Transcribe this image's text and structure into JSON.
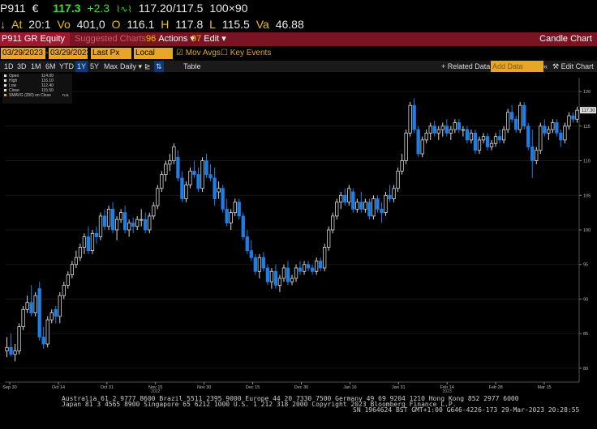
{
  "quote": {
    "ticker": "P911",
    "currency": "€",
    "last": "117.3",
    "change": "+2.3",
    "bid_ask": "117.20/117.5",
    "size": "100×90",
    "at_label": "At",
    "at_time": "20:1",
    "vol_label": "Vo",
    "volume": "401,0",
    "open_label": "O",
    "open": "116.1",
    "high_label": "H",
    "high": "117.8",
    "low_label": "L",
    "low": "115.5",
    "val_label": "Va",
    "value": "46.88"
  },
  "titlebar": {
    "security": "P911 GR Equity",
    "suggested": "Suggested Charts",
    "actions_num": "96",
    "actions": "Actions",
    "edit_num": "97",
    "edit": "Edit",
    "chart_name": "Candle Chart"
  },
  "toolbar": {
    "start_date": "03/29/2023",
    "end_date": "03/29/2023",
    "field": "Last Px",
    "currency": "Local CCY",
    "mov_avgs": "Mov Avgs",
    "key_events": "Key Events",
    "periods": [
      "1D",
      "3D",
      "1M",
      "6M",
      "YTD",
      "1Y",
      "5Y",
      "Max"
    ],
    "active_period": "1Y",
    "frequency": "Daily",
    "table": "Table",
    "related": "Related Data",
    "add_data": "Add Data",
    "edit_chart": "Edit Chart"
  },
  "legend": {
    "rows": [
      {
        "k": "Open",
        "v": "114.00"
      },
      {
        "k": "High",
        "v": "116.10"
      },
      {
        "k": "Low",
        "v": "112.40"
      },
      {
        "k": "Close",
        "v": "115.50"
      },
      {
        "k": "SMAVG (200) on Close",
        "v": "n.a."
      }
    ]
  },
  "footer": {
    "line1": "Australia 61 2 9777 8600 Brazil 5511 2395 9000 Europe 44 20 7330 7500 Germany 49 69 9204 1210 Hong Kong 852 2977 6000",
    "line2": "Japan 81 3 4565 8900     Singapore 65 6212 1000     U.S. 1 212 318 2000          Copyright 2023 Bloomberg Finance L.P.",
    "line3": "SN 1964624 BST  GMT+1:00 G646-4226-173 29-Mar-2023 20:28:55"
  },
  "colors": {
    "up": "#d8d8d8",
    "down": "#1e7ee8",
    "accent": "#e8a628",
    "title": "#7a1422"
  },
  "chart_data": {
    "type": "candlestick",
    "ylim": [
      78,
      122
    ],
    "yticks": [
      80,
      85,
      90,
      95,
      100,
      105,
      110,
      115,
      120
    ],
    "x_ticks": [
      "Sep 30",
      "Oct 14",
      "Oct 31",
      "Nov 15",
      "Nov 30",
      "Dec 15",
      "Dec 30",
      "Jan 16",
      "Jan 31",
      "Feb 14",
      "Feb 28",
      "Mar 15"
    ],
    "x_year_labels": [
      {
        "under": "Nov 15",
        "text": "2022"
      },
      {
        "under": "Feb 14",
        "text": "2023"
      }
    ],
    "last_price": "117.30",
    "candles": [
      {
        "o": 82.5,
        "h": 84.5,
        "l": 81.6,
        "c": 83.0
      },
      {
        "o": 83.0,
        "h": 85.0,
        "l": 81.7,
        "c": 82.0
      },
      {
        "o": 82.0,
        "h": 83.5,
        "l": 81.0,
        "c": 82.5
      },
      {
        "o": 82.5,
        "h": 86.5,
        "l": 82.0,
        "c": 86.0
      },
      {
        "o": 86.0,
        "h": 89.0,
        "l": 85.5,
        "c": 88.5
      },
      {
        "o": 88.5,
        "h": 90.5,
        "l": 88.0,
        "c": 89.5
      },
      {
        "o": 89.5,
        "h": 92.0,
        "l": 87.5,
        "c": 88.0
      },
      {
        "o": 88.0,
        "h": 91.0,
        "l": 87.5,
        "c": 90.5
      },
      {
        "o": 91.5,
        "h": 92.5,
        "l": 84.0,
        "c": 84.5
      },
      {
        "o": 84.5,
        "h": 86.0,
        "l": 82.8,
        "c": 83.5
      },
      {
        "o": 83.5,
        "h": 87.5,
        "l": 83.0,
        "c": 87.0
      },
      {
        "o": 87.0,
        "h": 88.5,
        "l": 86.5,
        "c": 88.0
      },
      {
        "o": 88.5,
        "h": 89.0,
        "l": 86.5,
        "c": 87.5
      },
      {
        "o": 87.5,
        "h": 91.0,
        "l": 86.5,
        "c": 90.5
      },
      {
        "o": 90.5,
        "h": 92.5,
        "l": 90.0,
        "c": 92.0
      },
      {
        "o": 92.0,
        "h": 94.0,
        "l": 91.5,
        "c": 93.5
      },
      {
        "o": 93.5,
        "h": 95.5,
        "l": 93.0,
        "c": 95.0
      },
      {
        "o": 95.0,
        "h": 97.0,
        "l": 94.5,
        "c": 96.0
      },
      {
        "o": 96.0,
        "h": 98.0,
        "l": 95.5,
        "c": 97.5
      },
      {
        "o": 97.5,
        "h": 99.5,
        "l": 96.5,
        "c": 99.0
      },
      {
        "o": 99.0,
        "h": 100.5,
        "l": 96.5,
        "c": 97.0
      },
      {
        "o": 97.0,
        "h": 100.0,
        "l": 96.5,
        "c": 99.5
      },
      {
        "o": 99.5,
        "h": 100.5,
        "l": 98.0,
        "c": 99.0
      },
      {
        "o": 99.0,
        "h": 102.5,
        "l": 98.5,
        "c": 102.0
      },
      {
        "o": 102.0,
        "h": 103.0,
        "l": 100.0,
        "c": 100.5
      },
      {
        "o": 100.5,
        "h": 103.5,
        "l": 100.0,
        "c": 103.0
      },
      {
        "o": 103.0,
        "h": 104.0,
        "l": 99.5,
        "c": 100.0
      },
      {
        "o": 100.0,
        "h": 102.0,
        "l": 98.5,
        "c": 101.5
      },
      {
        "o": 101.5,
        "h": 103.0,
        "l": 101.0,
        "c": 102.5
      },
      {
        "o": 102.5,
        "h": 103.5,
        "l": 99.5,
        "c": 100.0
      },
      {
        "o": 100.0,
        "h": 101.5,
        "l": 99.0,
        "c": 101.0
      },
      {
        "o": 101.0,
        "h": 101.8,
        "l": 99.5,
        "c": 100.5
      },
      {
        "o": 100.5,
        "h": 102.0,
        "l": 100.0,
        "c": 101.5
      },
      {
        "o": 101.5,
        "h": 103.0,
        "l": 100.5,
        "c": 101.5
      },
      {
        "o": 101.5,
        "h": 102.5,
        "l": 99.5,
        "c": 100.0
      },
      {
        "o": 100.0,
        "h": 102.5,
        "l": 99.5,
        "c": 102.0
      },
      {
        "o": 102.0,
        "h": 104.0,
        "l": 101.5,
        "c": 103.5
      },
      {
        "o": 103.5,
        "h": 106.5,
        "l": 103.0,
        "c": 106.0
      },
      {
        "o": 106.0,
        "h": 108.5,
        "l": 105.5,
        "c": 108.0
      },
      {
        "o": 108.0,
        "h": 110.0,
        "l": 107.0,
        "c": 109.5
      },
      {
        "o": 109.5,
        "h": 111.0,
        "l": 108.5,
        "c": 110.0
      },
      {
        "o": 110.0,
        "h": 112.5,
        "l": 109.5,
        "c": 112.0
      },
      {
        "o": 110.5,
        "h": 111.5,
        "l": 107.0,
        "c": 107.5
      },
      {
        "o": 107.5,
        "h": 108.5,
        "l": 104.0,
        "c": 104.5
      },
      {
        "o": 104.5,
        "h": 107.0,
        "l": 104.0,
        "c": 106.5
      },
      {
        "o": 106.5,
        "h": 109.0,
        "l": 106.0,
        "c": 108.5
      },
      {
        "o": 108.5,
        "h": 110.0,
        "l": 107.5,
        "c": 108.0
      },
      {
        "o": 108.0,
        "h": 109.0,
        "l": 105.5,
        "c": 106.0
      },
      {
        "o": 106.0,
        "h": 110.5,
        "l": 105.5,
        "c": 110.0
      },
      {
        "o": 110.0,
        "h": 111.0,
        "l": 107.5,
        "c": 108.0
      },
      {
        "o": 108.0,
        "h": 109.5,
        "l": 107.0,
        "c": 107.5
      },
      {
        "o": 107.5,
        "h": 109.0,
        "l": 103.5,
        "c": 104.5
      },
      {
        "o": 105.5,
        "h": 107.0,
        "l": 104.5,
        "c": 106.0
      },
      {
        "o": 106.0,
        "h": 106.5,
        "l": 102.5,
        "c": 103.0
      },
      {
        "o": 103.0,
        "h": 104.5,
        "l": 100.5,
        "c": 101.0
      },
      {
        "o": 101.0,
        "h": 103.0,
        "l": 100.0,
        "c": 102.5
      },
      {
        "o": 102.5,
        "h": 104.5,
        "l": 102.0,
        "c": 104.0
      },
      {
        "o": 104.0,
        "h": 104.5,
        "l": 101.5,
        "c": 102.0
      },
      {
        "o": 102.0,
        "h": 102.5,
        "l": 98.5,
        "c": 99.0
      },
      {
        "o": 99.0,
        "h": 100.0,
        "l": 96.5,
        "c": 97.0
      },
      {
        "o": 97.0,
        "h": 98.5,
        "l": 95.5,
        "c": 96.0
      },
      {
        "o": 96.0,
        "h": 96.5,
        "l": 93.5,
        "c": 94.0
      },
      {
        "o": 94.0,
        "h": 96.5,
        "l": 93.0,
        "c": 96.0
      },
      {
        "o": 96.0,
        "h": 96.8,
        "l": 94.0,
        "c": 94.5
      },
      {
        "o": 94.5,
        "h": 95.0,
        "l": 92.0,
        "c": 92.5
      },
      {
        "o": 92.5,
        "h": 94.5,
        "l": 91.5,
        "c": 94.0
      },
      {
        "o": 94.0,
        "h": 95.0,
        "l": 91.5,
        "c": 92.0
      },
      {
        "o": 92.0,
        "h": 93.5,
        "l": 91.0,
        "c": 93.0
      },
      {
        "o": 93.0,
        "h": 95.0,
        "l": 92.5,
        "c": 94.5
      },
      {
        "o": 94.5,
        "h": 95.5,
        "l": 92.0,
        "c": 92.5
      },
      {
        "o": 92.5,
        "h": 93.5,
        "l": 92.0,
        "c": 93.0
      },
      {
        "o": 93.0,
        "h": 95.0,
        "l": 92.5,
        "c": 94.5
      },
      {
        "o": 94.5,
        "h": 95.5,
        "l": 93.5,
        "c": 94.0
      },
      {
        "o": 94.0,
        "h": 95.5,
        "l": 93.5,
        "c": 95.0
      },
      {
        "o": 95.0,
        "h": 95.5,
        "l": 94.0,
        "c": 94.5
      },
      {
        "o": 94.5,
        "h": 95.0,
        "l": 93.5,
        "c": 94.0
      },
      {
        "o": 94.0,
        "h": 96.0,
        "l": 93.5,
        "c": 95.5
      },
      {
        "o": 95.5,
        "h": 96.0,
        "l": 94.0,
        "c": 94.5
      },
      {
        "o": 94.5,
        "h": 98.0,
        "l": 94.0,
        "c": 97.5
      },
      {
        "o": 97.5,
        "h": 100.5,
        "l": 97.0,
        "c": 100.0
      },
      {
        "o": 100.0,
        "h": 102.5,
        "l": 99.5,
        "c": 102.0
      },
      {
        "o": 102.0,
        "h": 104.5,
        "l": 101.5,
        "c": 104.0
      },
      {
        "o": 104.0,
        "h": 105.5,
        "l": 103.0,
        "c": 105.0
      },
      {
        "o": 105.0,
        "h": 106.0,
        "l": 103.5,
        "c": 104.0
      },
      {
        "o": 104.0,
        "h": 106.5,
        "l": 103.5,
        "c": 106.0
      },
      {
        "o": 105.5,
        "h": 106.0,
        "l": 102.5,
        "c": 103.0
      },
      {
        "o": 103.0,
        "h": 104.5,
        "l": 102.5,
        "c": 104.0
      },
      {
        "o": 104.0,
        "h": 105.5,
        "l": 102.5,
        "c": 103.0
      },
      {
        "o": 103.0,
        "h": 104.5,
        "l": 102.5,
        "c": 104.0
      },
      {
        "o": 104.0,
        "h": 104.5,
        "l": 101.5,
        "c": 102.0
      },
      {
        "o": 102.0,
        "h": 105.0,
        "l": 101.5,
        "c": 104.5
      },
      {
        "o": 104.5,
        "h": 105.0,
        "l": 102.5,
        "c": 103.0
      },
      {
        "o": 103.0,
        "h": 104.0,
        "l": 101.0,
        "c": 102.5
      },
      {
        "o": 102.5,
        "h": 105.5,
        "l": 102.0,
        "c": 105.0
      },
      {
        "o": 105.0,
        "h": 106.5,
        "l": 104.0,
        "c": 104.5
      },
      {
        "o": 104.5,
        "h": 106.5,
        "l": 104.0,
        "c": 106.0
      },
      {
        "o": 106.0,
        "h": 109.0,
        "l": 105.5,
        "c": 108.5
      },
      {
        "o": 108.5,
        "h": 111.0,
        "l": 108.0,
        "c": 110.0
      },
      {
        "o": 110.0,
        "h": 114.5,
        "l": 109.5,
        "c": 114.0
      },
      {
        "o": 114.0,
        "h": 118.5,
        "l": 113.5,
        "c": 118.0
      },
      {
        "o": 118.0,
        "h": 119.0,
        "l": 114.0,
        "c": 114.5
      },
      {
        "o": 114.5,
        "h": 115.0,
        "l": 110.5,
        "c": 111.0
      },
      {
        "o": 111.0,
        "h": 113.5,
        "l": 110.5,
        "c": 113.0
      },
      {
        "o": 113.0,
        "h": 114.5,
        "l": 112.5,
        "c": 114.0
      },
      {
        "o": 114.0,
        "h": 115.5,
        "l": 113.0,
        "c": 115.0
      },
      {
        "o": 115.0,
        "h": 115.8,
        "l": 113.5,
        "c": 114.0
      },
      {
        "o": 114.0,
        "h": 115.0,
        "l": 113.0,
        "c": 114.5
      },
      {
        "o": 114.5,
        "h": 115.5,
        "l": 113.5,
        "c": 115.0
      },
      {
        "o": 115.0,
        "h": 116.0,
        "l": 113.5,
        "c": 114.0
      },
      {
        "o": 114.0,
        "h": 115.0,
        "l": 113.0,
        "c": 114.5
      },
      {
        "o": 114.5,
        "h": 116.0,
        "l": 114.0,
        "c": 115.5
      },
      {
        "o": 115.5,
        "h": 116.0,
        "l": 114.0,
        "c": 114.5
      },
      {
        "o": 114.5,
        "h": 115.0,
        "l": 113.5,
        "c": 114.5
      },
      {
        "o": 114.5,
        "h": 115.0,
        "l": 112.5,
        "c": 113.0
      },
      {
        "o": 113.0,
        "h": 114.5,
        "l": 112.5,
        "c": 114.0
      },
      {
        "o": 114.0,
        "h": 114.5,
        "l": 111.0,
        "c": 111.5
      },
      {
        "o": 111.5,
        "h": 113.5,
        "l": 111.0,
        "c": 113.0
      },
      {
        "o": 113.0,
        "h": 114.0,
        "l": 112.5,
        "c": 113.5
      },
      {
        "o": 113.5,
        "h": 114.0,
        "l": 111.5,
        "c": 112.0
      },
      {
        "o": 112.0,
        "h": 113.0,
        "l": 111.5,
        "c": 112.5
      },
      {
        "o": 112.5,
        "h": 114.0,
        "l": 112.0,
        "c": 113.5
      },
      {
        "o": 113.5,
        "h": 114.5,
        "l": 112.5,
        "c": 113.0
      },
      {
        "o": 113.0,
        "h": 115.0,
        "l": 112.5,
        "c": 114.5
      },
      {
        "o": 114.5,
        "h": 117.5,
        "l": 114.0,
        "c": 117.0
      },
      {
        "o": 117.0,
        "h": 118.0,
        "l": 115.5,
        "c": 116.0
      },
      {
        "o": 116.0,
        "h": 116.5,
        "l": 114.0,
        "c": 114.5
      },
      {
        "o": 114.5,
        "h": 118.5,
        "l": 114.0,
        "c": 118.0
      },
      {
        "o": 118.0,
        "h": 118.5,
        "l": 114.5,
        "c": 115.0
      },
      {
        "o": 115.0,
        "h": 115.5,
        "l": 111.5,
        "c": 112.0
      },
      {
        "o": 112.0,
        "h": 114.5,
        "l": 107.5,
        "c": 110.0
      },
      {
        "o": 110.0,
        "h": 112.0,
        "l": 109.5,
        "c": 111.5
      },
      {
        "o": 111.5,
        "h": 115.5,
        "l": 111.0,
        "c": 115.0
      },
      {
        "o": 115.0,
        "h": 116.0,
        "l": 113.5,
        "c": 114.0
      },
      {
        "o": 114.0,
        "h": 115.0,
        "l": 113.0,
        "c": 114.5
      },
      {
        "o": 114.5,
        "h": 116.0,
        "l": 114.0,
        "c": 115.5
      },
      {
        "o": 115.5,
        "h": 116.0,
        "l": 113.5,
        "c": 114.0
      },
      {
        "o": 114.0,
        "h": 114.5,
        "l": 112.0,
        "c": 113.0
      },
      {
        "o": 113.0,
        "h": 115.5,
        "l": 112.5,
        "c": 115.0
      },
      {
        "o": 115.0,
        "h": 117.0,
        "l": 114.5,
        "c": 116.5
      },
      {
        "o": 116.5,
        "h": 117.0,
        "l": 115.5,
        "c": 116.0
      },
      {
        "o": 116.0,
        "h": 117.8,
        "l": 115.5,
        "c": 117.3
      }
    ]
  }
}
